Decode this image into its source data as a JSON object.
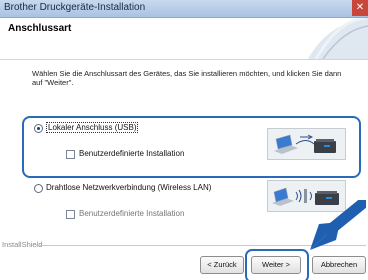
{
  "window": {
    "title": "Brother Druckgeräte-Installation",
    "close_glyph": "✕"
  },
  "header": {
    "title": "Anschlussart"
  },
  "description": "Wählen Sie die Anschlussart des Gerätes, das Sie installieren möchten, und klicken Sie dann auf \"Weiter\".",
  "options": {
    "usb": {
      "label": "Lokaler Anschluss (USB)",
      "selected": true,
      "custom_install_label": "Benutzerdefinierte Installation",
      "custom_install_checked": false,
      "icon": "usb-connection-icon"
    },
    "wlan": {
      "label": "Drahtlose Netzwerkverbindung (Wireless LAN)",
      "selected": false,
      "custom_install_label": "Benutzerdefinierte Installation",
      "custom_install_checked": false,
      "icon": "wireless-connection-icon"
    }
  },
  "footer": {
    "brand": "InstallShield",
    "back_label": "< Zurück",
    "next_label": "Weiter >",
    "cancel_label": "Abbrechen"
  },
  "colors": {
    "highlight": "#2a6ab8",
    "titlebar": "#a9c2e3"
  }
}
